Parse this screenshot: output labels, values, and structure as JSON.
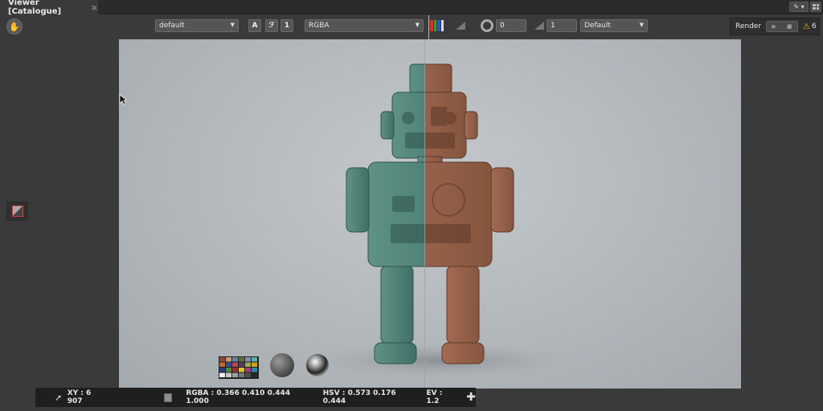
{
  "tab": {
    "title": "Viewer [Catalogue]",
    "close_glyph": "×"
  },
  "toolbar": {
    "lut_value": "default",
    "channel_value": "RGBA",
    "gain_value": "0",
    "gamma_value": "1",
    "display_value": "Default",
    "a_label": "A",
    "info_label": "1"
  },
  "render": {
    "label": "Render",
    "warning_count": "6"
  },
  "infobar": {
    "xy": "XY : 6 907",
    "rgba": "RGBA : 0.366 0.410 0.444 1.000",
    "hsv": "HSV : 0.573 0.176 0.444",
    "ev": "EV : 1.2"
  },
  "colors": {
    "robot_left": "#4d8478",
    "robot_right": "#9a6650",
    "warning": "#f0b429"
  },
  "chart_swatch": [
    "#8a4a3a",
    "#c49a7a",
    "#6a80a0",
    "#5a7040",
    "#8a8ab0",
    "#5ab0a0",
    "#c06a2a",
    "#3a4a8a",
    "#b04a5a",
    "#5a3a6a",
    "#9ab03a",
    "#d0a020",
    "#2a3a7a",
    "#4a8a3a",
    "#a02a2a",
    "#e0c020",
    "#a03a8a",
    "#2a8aa0",
    "#f0f0f0",
    "#c8c8c8",
    "#a0a0a0",
    "#787878",
    "#505050",
    "#282828"
  ]
}
